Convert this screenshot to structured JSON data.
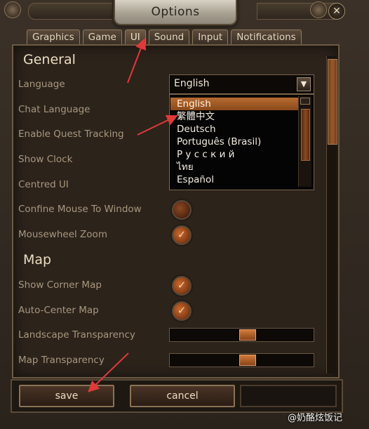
{
  "window": {
    "title": "Options",
    "close_label": "✕"
  },
  "tabs": [
    {
      "label": "Graphics"
    },
    {
      "label": "Game"
    },
    {
      "label": "UI"
    },
    {
      "label": "Sound"
    },
    {
      "label": "Input"
    },
    {
      "label": "Notifications"
    }
  ],
  "general": {
    "heading": "General",
    "language_label": "Language",
    "chat_language_label": "Chat Language",
    "quest_tracking_label": "Enable Quest Tracking",
    "show_clock_label": "Show Clock",
    "centred_ui_label": "Centred UI",
    "confine_mouse_label": "Confine Mouse To Window",
    "mousewheel_zoom_label": "Mousewheel Zoom"
  },
  "language_select": {
    "value": "English",
    "options": [
      "English",
      "繁體中文",
      "Deutsch",
      "Português (Brasil)",
      "Р у с с к и й",
      "ไทย",
      "Español"
    ]
  },
  "map": {
    "heading": "Map",
    "show_corner_map_label": "Show Corner Map",
    "auto_center_map_label": "Auto-Center Map",
    "landscape_transparency_label": "Landscape Transparency",
    "map_transparency_label": "Map Transparency"
  },
  "checkbox_states": {
    "confine_mouse": false,
    "mousewheel_zoom": true,
    "show_corner_map": true,
    "auto_center_map": true
  },
  "sliders": {
    "landscape_transparency": 0.5,
    "map_transparency": 0.5
  },
  "buttons": {
    "save": "save",
    "cancel": "cancel"
  },
  "watermark": "@奶酪炫饭记",
  "colors": {
    "accent": "#b76a30",
    "annotation": "#e0393a"
  }
}
